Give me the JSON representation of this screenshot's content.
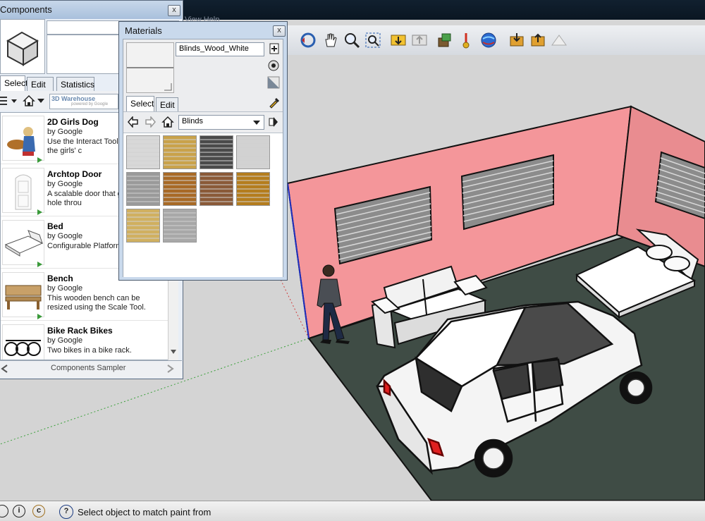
{
  "app": {
    "menu_partial": "View  Help"
  },
  "components_panel": {
    "title": "Components",
    "close": "x",
    "tabs": [
      "Select",
      "Edit",
      "Statistics"
    ],
    "warehouse_label": "3D Warehouse",
    "warehouse_sub": "powered by Google",
    "items": [
      {
        "name": "2D Girls Dog",
        "by": "by Google",
        "desc": "Use the Interact Tool the color of the girls' c"
      },
      {
        "name": "Archtop Door",
        "by": "by Google",
        "desc": "A scalable door that g and cuts a hole throu"
      },
      {
        "name": "Bed",
        "by": "by Google",
        "desc": "Configurable Platform"
      },
      {
        "name": "Bench",
        "by": "by Google",
        "desc": "This wooden bench can be resized using the Scale Tool."
      },
      {
        "name": "Bike Rack Bikes",
        "by": "by Google",
        "desc": "Two bikes in a bike rack."
      }
    ],
    "footer": "Components Sampler"
  },
  "materials_panel": {
    "title": "Materials",
    "close": "x",
    "material_name": "Blinds_Wood_White",
    "tabs": [
      "Select",
      "Edit"
    ],
    "library": "Blinds",
    "swatch_colors": [
      "#d8d8d8",
      "#c9a24a",
      "#4a4a4a",
      "#d2d2d2",
      "#9a9a9a",
      "#a86a26",
      "#8a5a38",
      "#b47d1e",
      "#d0b060",
      "#a8a8a8"
    ]
  },
  "status": {
    "text": "Select object to match paint from"
  },
  "colors": {
    "wall": "#f4969a",
    "floor": "#3d4a44",
    "accent": "#c9d9ec"
  }
}
